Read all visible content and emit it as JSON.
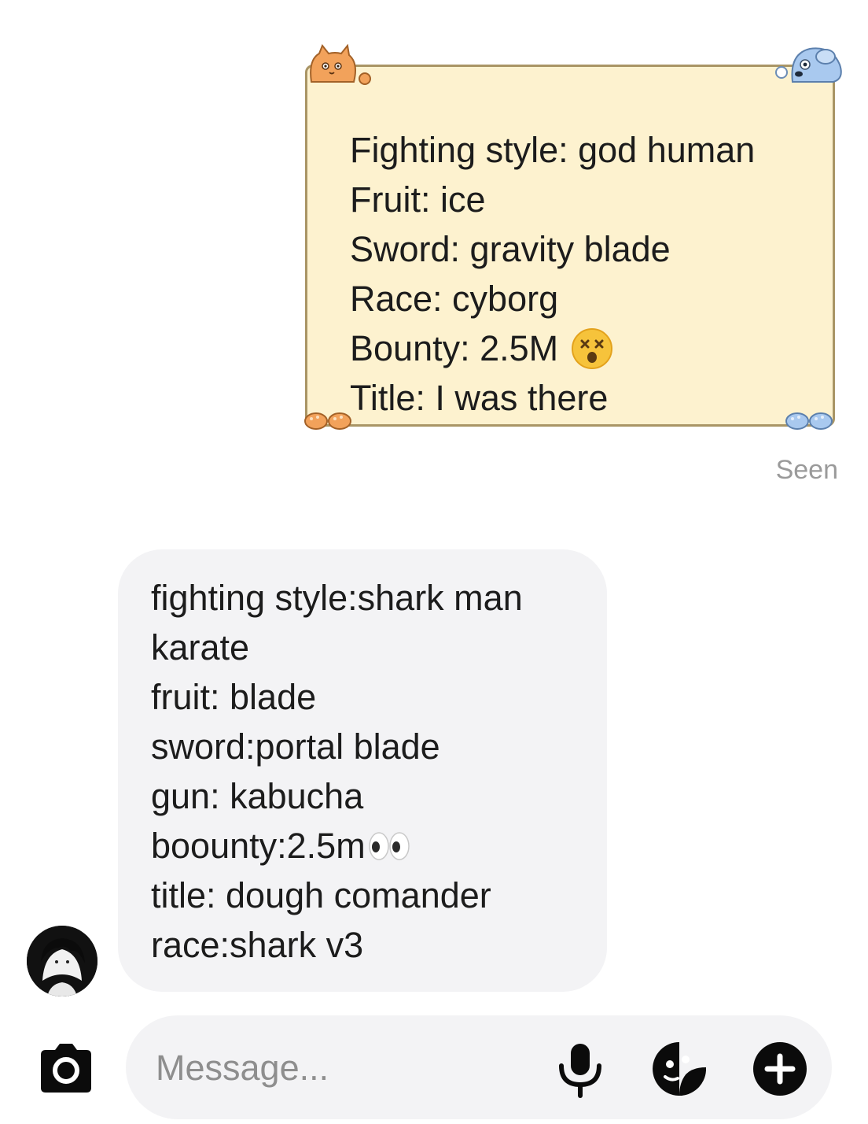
{
  "sent_message": {
    "lines": [
      "Fighting style: god human",
      "Fruit: ice",
      "Sword: gravity blade",
      "Race: cyborg",
      "Bounty: 2.5M",
      "Title: I was there"
    ],
    "bounty_emoji": "dizzy-face-emoji",
    "theme_colors": {
      "bubble_fill": "#fdf2cf",
      "bubble_border": "#a99565",
      "cat_orange": "#f2a25b",
      "dog_blue": "#a9c9ef"
    },
    "status": "Seen"
  },
  "received_message": {
    "lines": [
      "fighting style:shark man",
      "karate",
      "fruit: blade",
      "sword:portal blade",
      "gun: kabucha",
      "boounty:2.5m",
      "title: dough comander",
      "race:shark v3"
    ],
    "bounty_emoji": "eyes-emoji"
  },
  "composer": {
    "placeholder": "Message...",
    "icons": [
      "camera-icon",
      "microphone-icon",
      "sticker-icon",
      "plus-icon"
    ]
  }
}
